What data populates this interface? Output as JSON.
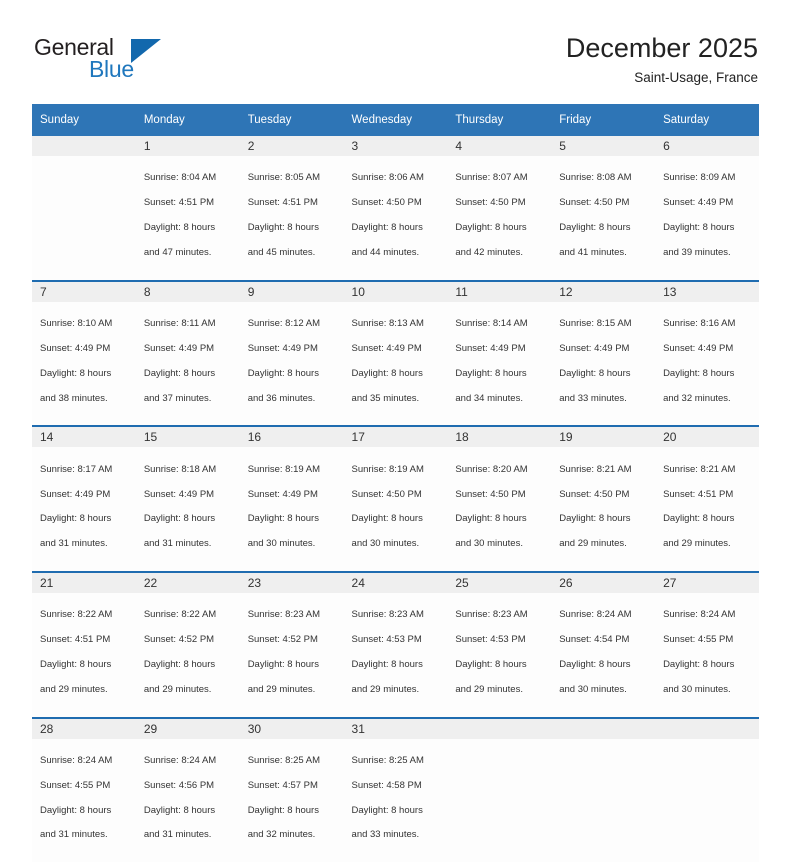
{
  "logo": {
    "word_one": "General",
    "word_two": "Blue",
    "triangle_color": "#1268ad",
    "blue_text_color": "#1f77bd"
  },
  "header": {
    "title": "December 2025",
    "subtitle": "Saint-Usage, France"
  },
  "theme": {
    "header_blue": "#2e75b6",
    "separator_blue": "#1f6cb0",
    "daynum_band": "#efefef"
  },
  "weekday_headers": [
    "Sunday",
    "Monday",
    "Tuesday",
    "Wednesday",
    "Thursday",
    "Friday",
    "Saturday"
  ],
  "weeks": [
    {
      "days": [
        {
          "num": "",
          "sunrise": "",
          "sunset": "",
          "daylight": "",
          "daylight2": ""
        },
        {
          "num": "1",
          "sunrise": "Sunrise: 8:04 AM",
          "sunset": "Sunset: 4:51 PM",
          "daylight": "Daylight: 8 hours",
          "daylight2": "and 47 minutes."
        },
        {
          "num": "2",
          "sunrise": "Sunrise: 8:05 AM",
          "sunset": "Sunset: 4:51 PM",
          "daylight": "Daylight: 8 hours",
          "daylight2": "and 45 minutes."
        },
        {
          "num": "3",
          "sunrise": "Sunrise: 8:06 AM",
          "sunset": "Sunset: 4:50 PM",
          "daylight": "Daylight: 8 hours",
          "daylight2": "and 44 minutes."
        },
        {
          "num": "4",
          "sunrise": "Sunrise: 8:07 AM",
          "sunset": "Sunset: 4:50 PM",
          "daylight": "Daylight: 8 hours",
          "daylight2": "and 42 minutes."
        },
        {
          "num": "5",
          "sunrise": "Sunrise: 8:08 AM",
          "sunset": "Sunset: 4:50 PM",
          "daylight": "Daylight: 8 hours",
          "daylight2": "and 41 minutes."
        },
        {
          "num": "6",
          "sunrise": "Sunrise: 8:09 AM",
          "sunset": "Sunset: 4:49 PM",
          "daylight": "Daylight: 8 hours",
          "daylight2": "and 39 minutes."
        }
      ]
    },
    {
      "days": [
        {
          "num": "7",
          "sunrise": "Sunrise: 8:10 AM",
          "sunset": "Sunset: 4:49 PM",
          "daylight": "Daylight: 8 hours",
          "daylight2": "and 38 minutes."
        },
        {
          "num": "8",
          "sunrise": "Sunrise: 8:11 AM",
          "sunset": "Sunset: 4:49 PM",
          "daylight": "Daylight: 8 hours",
          "daylight2": "and 37 minutes."
        },
        {
          "num": "9",
          "sunrise": "Sunrise: 8:12 AM",
          "sunset": "Sunset: 4:49 PM",
          "daylight": "Daylight: 8 hours",
          "daylight2": "and 36 minutes."
        },
        {
          "num": "10",
          "sunrise": "Sunrise: 8:13 AM",
          "sunset": "Sunset: 4:49 PM",
          "daylight": "Daylight: 8 hours",
          "daylight2": "and 35 minutes."
        },
        {
          "num": "11",
          "sunrise": "Sunrise: 8:14 AM",
          "sunset": "Sunset: 4:49 PM",
          "daylight": "Daylight: 8 hours",
          "daylight2": "and 34 minutes."
        },
        {
          "num": "12",
          "sunrise": "Sunrise: 8:15 AM",
          "sunset": "Sunset: 4:49 PM",
          "daylight": "Daylight: 8 hours",
          "daylight2": "and 33 minutes."
        },
        {
          "num": "13",
          "sunrise": "Sunrise: 8:16 AM",
          "sunset": "Sunset: 4:49 PM",
          "daylight": "Daylight: 8 hours",
          "daylight2": "and 32 minutes."
        }
      ]
    },
    {
      "days": [
        {
          "num": "14",
          "sunrise": "Sunrise: 8:17 AM",
          "sunset": "Sunset: 4:49 PM",
          "daylight": "Daylight: 8 hours",
          "daylight2": "and 31 minutes."
        },
        {
          "num": "15",
          "sunrise": "Sunrise: 8:18 AM",
          "sunset": "Sunset: 4:49 PM",
          "daylight": "Daylight: 8 hours",
          "daylight2": "and 31 minutes."
        },
        {
          "num": "16",
          "sunrise": "Sunrise: 8:19 AM",
          "sunset": "Sunset: 4:49 PM",
          "daylight": "Daylight: 8 hours",
          "daylight2": "and 30 minutes."
        },
        {
          "num": "17",
          "sunrise": "Sunrise: 8:19 AM",
          "sunset": "Sunset: 4:50 PM",
          "daylight": "Daylight: 8 hours",
          "daylight2": "and 30 minutes."
        },
        {
          "num": "18",
          "sunrise": "Sunrise: 8:20 AM",
          "sunset": "Sunset: 4:50 PM",
          "daylight": "Daylight: 8 hours",
          "daylight2": "and 30 minutes."
        },
        {
          "num": "19",
          "sunrise": "Sunrise: 8:21 AM",
          "sunset": "Sunset: 4:50 PM",
          "daylight": "Daylight: 8 hours",
          "daylight2": "and 29 minutes."
        },
        {
          "num": "20",
          "sunrise": "Sunrise: 8:21 AM",
          "sunset": "Sunset: 4:51 PM",
          "daylight": "Daylight: 8 hours",
          "daylight2": "and 29 minutes."
        }
      ]
    },
    {
      "days": [
        {
          "num": "21",
          "sunrise": "Sunrise: 8:22 AM",
          "sunset": "Sunset: 4:51 PM",
          "daylight": "Daylight: 8 hours",
          "daylight2": "and 29 minutes."
        },
        {
          "num": "22",
          "sunrise": "Sunrise: 8:22 AM",
          "sunset": "Sunset: 4:52 PM",
          "daylight": "Daylight: 8 hours",
          "daylight2": "and 29 minutes."
        },
        {
          "num": "23",
          "sunrise": "Sunrise: 8:23 AM",
          "sunset": "Sunset: 4:52 PM",
          "daylight": "Daylight: 8 hours",
          "daylight2": "and 29 minutes."
        },
        {
          "num": "24",
          "sunrise": "Sunrise: 8:23 AM",
          "sunset": "Sunset: 4:53 PM",
          "daylight": "Daylight: 8 hours",
          "daylight2": "and 29 minutes."
        },
        {
          "num": "25",
          "sunrise": "Sunrise: 8:23 AM",
          "sunset": "Sunset: 4:53 PM",
          "daylight": "Daylight: 8 hours",
          "daylight2": "and 29 minutes."
        },
        {
          "num": "26",
          "sunrise": "Sunrise: 8:24 AM",
          "sunset": "Sunset: 4:54 PM",
          "daylight": "Daylight: 8 hours",
          "daylight2": "and 30 minutes."
        },
        {
          "num": "27",
          "sunrise": "Sunrise: 8:24 AM",
          "sunset": "Sunset: 4:55 PM",
          "daylight": "Daylight: 8 hours",
          "daylight2": "and 30 minutes."
        }
      ]
    },
    {
      "days": [
        {
          "num": "28",
          "sunrise": "Sunrise: 8:24 AM",
          "sunset": "Sunset: 4:55 PM",
          "daylight": "Daylight: 8 hours",
          "daylight2": "and 31 minutes."
        },
        {
          "num": "29",
          "sunrise": "Sunrise: 8:24 AM",
          "sunset": "Sunset: 4:56 PM",
          "daylight": "Daylight: 8 hours",
          "daylight2": "and 31 minutes."
        },
        {
          "num": "30",
          "sunrise": "Sunrise: 8:25 AM",
          "sunset": "Sunset: 4:57 PM",
          "daylight": "Daylight: 8 hours",
          "daylight2": "and 32 minutes."
        },
        {
          "num": "31",
          "sunrise": "Sunrise: 8:25 AM",
          "sunset": "Sunset: 4:58 PM",
          "daylight": "Daylight: 8 hours",
          "daylight2": "and 33 minutes."
        },
        {
          "num": "",
          "sunrise": "",
          "sunset": "",
          "daylight": "",
          "daylight2": ""
        },
        {
          "num": "",
          "sunrise": "",
          "sunset": "",
          "daylight": "",
          "daylight2": ""
        },
        {
          "num": "",
          "sunrise": "",
          "sunset": "",
          "daylight": "",
          "daylight2": ""
        }
      ]
    }
  ]
}
